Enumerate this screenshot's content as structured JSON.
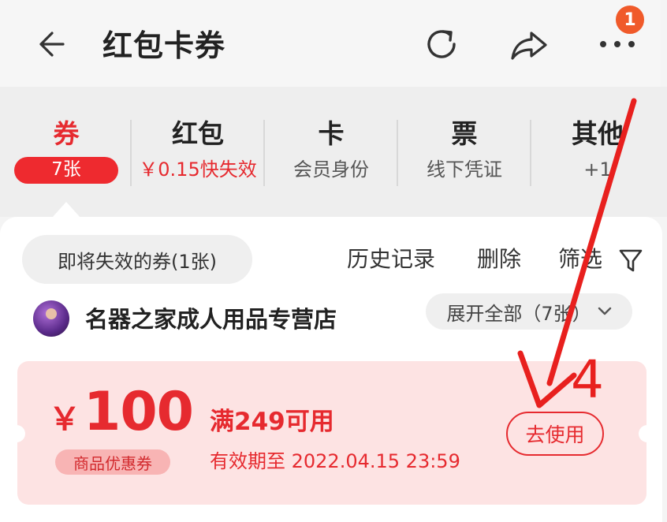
{
  "header": {
    "title": "红包卡券",
    "more_badge": "1"
  },
  "tabs": [
    {
      "title": "券",
      "sub": "7张",
      "active": true
    },
    {
      "title": "红包",
      "sub": "￥0.15快失效"
    },
    {
      "title": "卡",
      "sub": "会员身份"
    },
    {
      "title": "票",
      "sub": "线下凭证"
    },
    {
      "title": "其他",
      "sub": "+1"
    }
  ],
  "toolbar": {
    "expiring_label": "即将失效的券(1张)",
    "history_label": "历史记录",
    "delete_label": "删除",
    "filter_label": "筛选"
  },
  "store": {
    "name": "名器之家成人用品专营店",
    "expand_label": "展开全部（7张）"
  },
  "coupon": {
    "currency": "￥",
    "amount": "100",
    "type_label": "商品优惠券",
    "condition": "满249可用",
    "validity": "有效期至 2022.04.15 23:59",
    "use_label": "去使用"
  },
  "annotation": {
    "number": "4",
    "color": "#e8201e"
  },
  "colors": {
    "accent": "#e62a2f",
    "coupon_bg": "#fde3e3",
    "badge": "#f05a2a"
  }
}
